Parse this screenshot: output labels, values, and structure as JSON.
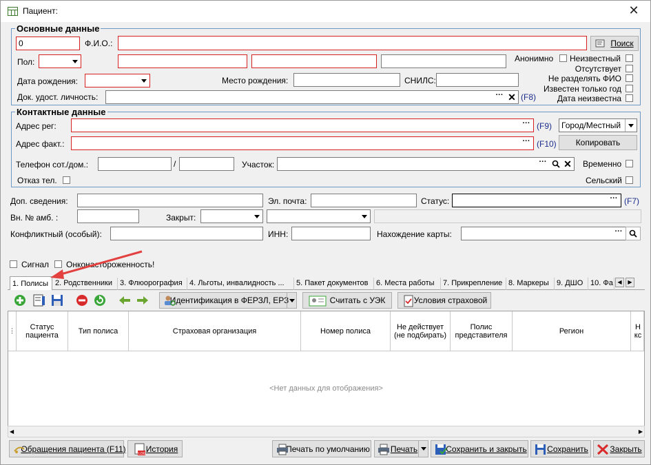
{
  "window": {
    "title": "Пациент:",
    "close": "✕"
  },
  "basic": {
    "title": "Основные данные",
    "id_value": "0",
    "fio_label": "Ф.И.О.:",
    "search_btn": "Поиск",
    "sex_label": "Пол:",
    "anon_label": "Анонимно",
    "unknown_label": "Неизвестный",
    "absent_label": "Отсутствует",
    "no_split_label": "Не разделять ФИО",
    "only_year_label": "Известен только год",
    "date_unknown_label": "Дата неизвестна",
    "dob_label": "Дата рождения:",
    "pob_label": "Место рождения:",
    "snils_label": "СНИЛС:",
    "doc_label": "Док. удост. личность:",
    "doc_key": "(F8)"
  },
  "contact": {
    "title": "Контактные данные",
    "addr_reg_label": "Адрес рег:",
    "addr_reg_key": "(F9)",
    "city_value": "Город/Местный",
    "addr_fact_label": "Адрес факт.:",
    "addr_fact_key": "(F10)",
    "copy_btn": "Копировать",
    "phone_label": "Телефон сот./дом.:",
    "phone_sep": "/",
    "area_label": "Участок:",
    "temp_label": "Временно",
    "refuse_label": "Отказ тел.",
    "rural_label": "Сельский"
  },
  "extra": {
    "info_label": "Доп. сведения:",
    "email_label": "Эл. почта:",
    "status_label": "Статус:",
    "status_key": "(F7)",
    "amb_label": "Вн. № амб. :",
    "closed_label": "Закрыт:",
    "conflict_label": "Конфликтный (особый):",
    "inn_label": "ИНН:",
    "card_label": "Нахождение карты:",
    "signal_label": "Сигнал",
    "onco_label": "Онконастороженность!"
  },
  "tabs": [
    "1. Полисы",
    "2. Родственники",
    "3. Флюорография",
    "4. Льготы, инвалидность ...",
    "5. Пакет документов",
    "6. Места работы",
    "7. Прикрепление",
    "8. Маркеры",
    "9. ДШО",
    "10. Фа"
  ],
  "toolbar": {
    "ident_btn": "Идентификация в ФЕРЗЛ, ЕРЗ",
    "uek_btn": "Считать с УЭК",
    "terms_btn": "Условия страховой"
  },
  "grid": {
    "columns": [
      "Статус пациента",
      "Тип полиса",
      "Страховая организация",
      "Номер полиса",
      "Не действует (не подбирать)",
      "Полис представителя",
      "Регион",
      "Н кс"
    ],
    "empty_text": "<Нет данных для отображения>"
  },
  "footer": {
    "visits_btn": "Обращения пациента (F11)",
    "history_btn": "История",
    "print_default_btn": "Печать по умолчанию",
    "print_btn": "Печать",
    "save_close_btn": "Сохранить и закрыть",
    "save_btn": "Сохранить",
    "close_btn": "Закрыть"
  },
  "colors": {
    "required_border": "#d62020",
    "group_border": "#6d98c5",
    "hotkey": "#1b2c8c"
  }
}
